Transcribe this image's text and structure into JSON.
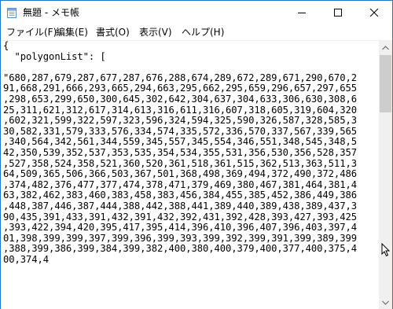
{
  "window": {
    "title": "無題 - メモ帳",
    "accent_color": "#1979ca"
  },
  "titlebar": {
    "icons": [
      "notepad-icon",
      "minimize-icon",
      "maximize-icon",
      "close-icon"
    ]
  },
  "menu": {
    "items": [
      {
        "label": "ファイル(F)"
      },
      {
        "label": "編集(E)"
      },
      {
        "label": "書式(O)"
      },
      {
        "label": "表示(V)"
      },
      {
        "label": "ヘルプ(H)"
      }
    ]
  },
  "editor": {
    "lines": [
      "{",
      "  \"polygonList\": [",
      "",
      "\"680,287,679,287,677,287,676,288,674,289,672,289,671,290,670,291,668,291,666,293,665,294,663,295,662,295,659,296,657,297,655,298,653,299,650,300,645,302,642,304,637,304,633,306,630,308,625,311,621,312,617,314,613,316,611,316,607,318,605,319,604,320,602,321,599,322,597,323,596,324,594,325,590,326,587,328,585,330,582,331,579,333,576,334,574,335,572,336,570,337,567,339,565,340,564,342,561,344,559,345,557,345,554,346,551,348,545,348,542,350,539,352,537,353,535,354,534,355,531,356,530,356,528,357,527,358,524,358,521,360,520,361,518,361,515,362,513,363,511,364,509,365,506,366,503,367,501,368,498,369,494,372,490,372,486,374,482,376,477,377,474,378,471,379,469,380,467,381,464,381,463,382,462,383,460,383,458,383,456,384,455,385,452,386,449,386,448,387,446,387,444,388,442,388,441,389,440,389,438,389,437,390,435,391,433,391,432,391,432,392,431,392,428,393,427,393,425,393,422,394,420,395,417,395,414,396,410,396,407,396,403,397,401,398,399,399,397,399,396,399,393,399,392,399,391,399,389,399,388,399,386,399,384,399,382,400,380,400,379,400,377,400,375,400,374,4"
    ],
    "wrapped_lines": [
      "{",
      "  \"polygonList\": [",
      "",
      "\"680,287,679,287,677,287,676,288,674,289,672,289,671,290,670,291,668,291,666,293,665,294,663,295,662,295,659,296,657,297,655,298,653,299,650,300,645,302,642,304,637,304,633,306,630,308,625,311,621,312,617,314,613,316,611,316,607,318,605,319,604,320,602,321,599,322,597,323,596,324,594,325,590,326,587,328,585,330,582,331,579,333,576,334,574,335,572,336,570,337,567,339,565,340,564,342,561,344,559,345,557,345,554,346,551,348,545,348,542,350,539,352,537,353,535,354,534,355,531,356,530,356,528,357,527,358,524,358,521,360,520,361,518,361,515,362,513,363,511,364,509,365,506,366,503,367,501,368,498,369,494,372,490,372,486,374,482,376,477,377,474,378,471,379,469,380,467,381,464,381,463,382,462,383,460,383,458,383,456,384,455,385,452,386,449,386,448,387,446,387,444,388,442,388,441,389,440,389,438,389,437,390,435,391,433,391,432,391,432,392,431,392,428,393,427,393,425,393,422,394,420,395,417,395,414,396,410,396,407,396,403,397,401,398,399,399,397,399,396,399,393,399,392,399,391,399,389,399,388,399,386,399,384,399,382,400,380,400,379,400,377,400,375,400,374,4"
    ]
  },
  "scrollbar": {
    "colors": {
      "track": "#f0f0f0",
      "thumb": "#cdcdcd"
    },
    "icons": [
      "scroll-up-arrow-icon",
      "scroll-down-arrow-icon"
    ]
  }
}
